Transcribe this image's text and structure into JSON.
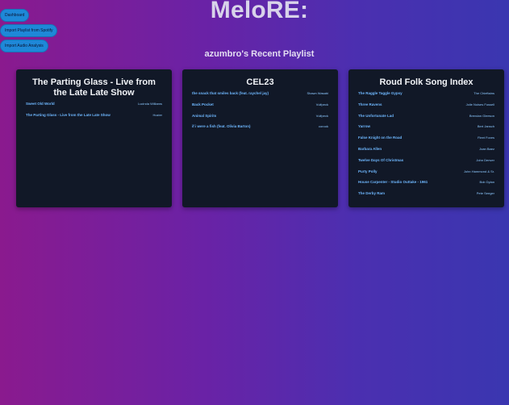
{
  "nav": {
    "dashboard": "Dashboard",
    "import_playlist": "Import Playlist from Spotify",
    "import_audio": "Import Audio Analysis"
  },
  "header": {
    "app_title": "MeloRE:",
    "subtitle": "azumbro's Recent Playlist"
  },
  "colors": {
    "accent": "#1e88d8",
    "card_bg": "#111827",
    "track_link": "#6fb8ff"
  },
  "playlists": [
    {
      "title": "The Parting Glass - Live from the Late Late Show",
      "tracks": [
        {
          "name": "Sweet Old World",
          "artist": "Lucinda Williams"
        },
        {
          "name": "The Parting Glass - Live from the Late Late Show",
          "artist": "Hozier"
        }
      ]
    },
    {
      "title": "CEL23",
      "tracks": [
        {
          "name": "the snack that smiles back (feat. raychel jay)",
          "artist": "Shawn Wasabi"
        },
        {
          "name": "Back Pocket",
          "artist": "Vulfpeck"
        },
        {
          "name": "Animal Spirits",
          "artist": "Vulfpeck"
        },
        {
          "name": "if i were a fish (feat. Olivia Barton)",
          "artist": "corook"
        }
      ]
    },
    {
      "title": "Roud Folk Song Index",
      "tracks": [
        {
          "name": "The Raggle Taggle Gypsy",
          "artist": "The Chieftains"
        },
        {
          "name": "Three Ravens",
          "artist": "Jolie Noises Fussell"
        },
        {
          "name": "The Unfortunate Lad",
          "artist": "Brendan Gleeson"
        },
        {
          "name": "Yarrow",
          "artist": "Bert Jansch"
        },
        {
          "name": "False Knight on the Road",
          "artist": "Fleet Foxes"
        },
        {
          "name": "Barbara Allen",
          "artist": "Joan Baez"
        },
        {
          "name": "Twelve Days Of Christmas",
          "artist": "John Denver"
        },
        {
          "name": "Purty Polly",
          "artist": "John Hammond & Sr."
        },
        {
          "name": "House Carpenter - Studio Outtake - 1961",
          "artist": "Bob Dylan"
        },
        {
          "name": "The Derby Ram",
          "artist": "Pete Seeger"
        }
      ]
    }
  ]
}
